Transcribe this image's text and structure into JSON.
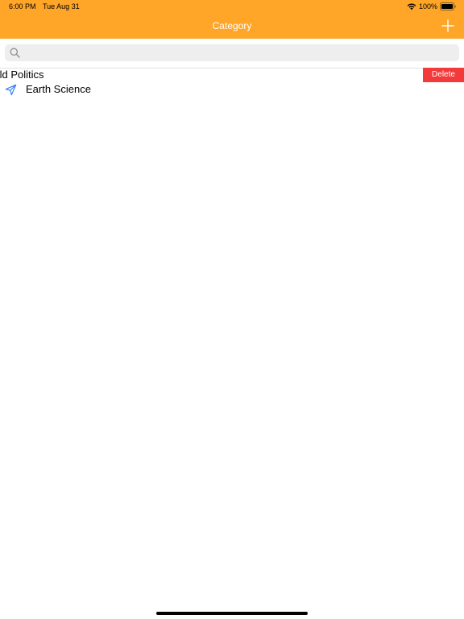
{
  "status_bar": {
    "time": "6:00 PM",
    "date": "Tue Aug 31",
    "battery_percent": "100%",
    "wifi_icon": "wifi-icon",
    "battery_icon": "battery-icon"
  },
  "nav_bar": {
    "title": "Category",
    "add_icon": "plus-icon",
    "color": "#FFA629"
  },
  "search": {
    "icon": "magnifying-glass-icon",
    "value": "",
    "placeholder": ""
  },
  "list": {
    "items": [
      {
        "label": "World Politics",
        "visible_label": "rld Politics",
        "swiped_open": true,
        "action": "Delete"
      },
      {
        "label": "Earth Science",
        "icon": "paper-plane-icon"
      }
    ],
    "delete_color": "#F23A3A",
    "icon_color": "#2F7BEF"
  }
}
